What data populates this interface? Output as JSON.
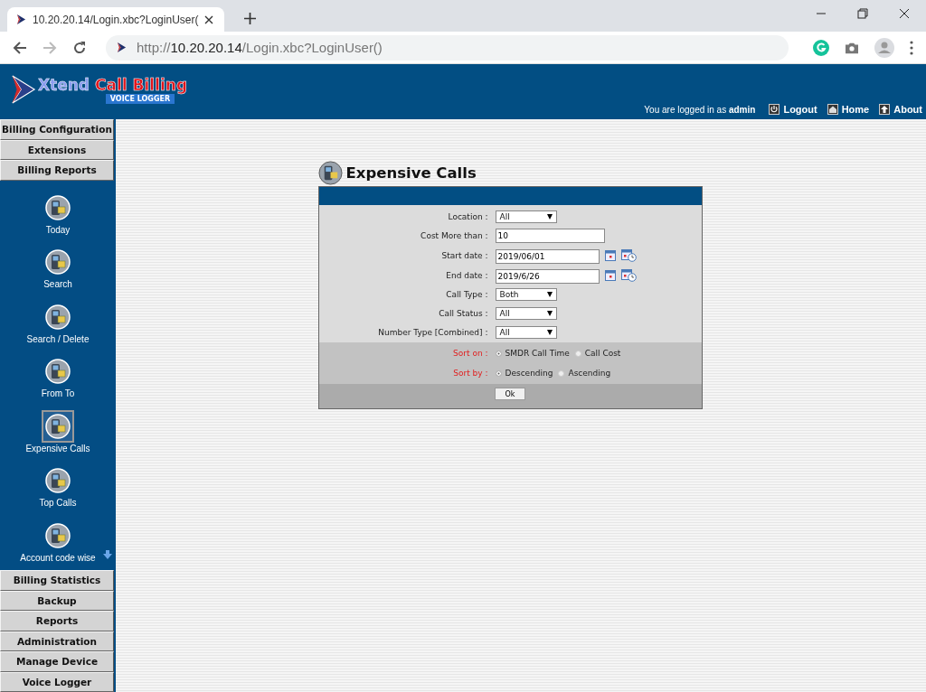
{
  "browser": {
    "tab_title": "10.20.20.14/Login.xbc?LoginUser(",
    "url_prefix": "http://",
    "url_host": "10.20.20.14",
    "url_path": "/Login.xbc?LoginUser()"
  },
  "header": {
    "logo_brand": "Xtend",
    "logo_product": "Call Billing",
    "logo_sub": "VOICE LOGGER",
    "login_text": "You are logged in as **admin**",
    "links": [
      {
        "label": "Logout",
        "kind": "logout"
      },
      {
        "label": "Home",
        "kind": "home"
      },
      {
        "label": "About",
        "kind": "about"
      }
    ]
  },
  "sidebar": {
    "top_sections": [
      "Billing Configuration",
      "Extensions",
      "Billing Reports"
    ],
    "items": [
      {
        "label": "Today",
        "selected": false
      },
      {
        "label": "Search",
        "selected": false
      },
      {
        "label": "Search / Delete",
        "selected": false
      },
      {
        "label": "From To",
        "selected": false
      },
      {
        "label": "Expensive Calls",
        "selected": true
      },
      {
        "label": "Top Calls",
        "selected": false
      },
      {
        "label": "Account code wise",
        "selected": false
      }
    ],
    "bottom_sections": [
      "Billing Statistics",
      "Backup",
      "Reports",
      "Administration",
      "Manage Device",
      "Voice Logger"
    ]
  },
  "form": {
    "title": "Expensive Calls",
    "fields": [
      {
        "kind": "select",
        "label": "Location :",
        "value": "All"
      },
      {
        "kind": "text",
        "label": "Cost More than :",
        "value": "10"
      },
      {
        "kind": "date",
        "label": "Start date :",
        "value": "2019/06/01"
      },
      {
        "kind": "date",
        "label": "End date :",
        "value": "2019/6/26"
      },
      {
        "kind": "select",
        "label": "Call Type :",
        "value": "Both"
      },
      {
        "kind": "select",
        "label": "Call Status :",
        "value": "All"
      },
      {
        "kind": "select",
        "label": "Number Type [Combined] :",
        "value": "All"
      }
    ],
    "sort_rows": [
      {
        "label": "Sort on :",
        "options": [
          {
            "label": "SMDR Call Time",
            "selected": true
          },
          {
            "label": "Call Cost",
            "selected": false
          }
        ]
      },
      {
        "label": "Sort by :",
        "options": [
          {
            "label": "Descending",
            "selected": true
          },
          {
            "label": "Ascending",
            "selected": false
          }
        ]
      }
    ],
    "ok_button": "Ok"
  }
}
